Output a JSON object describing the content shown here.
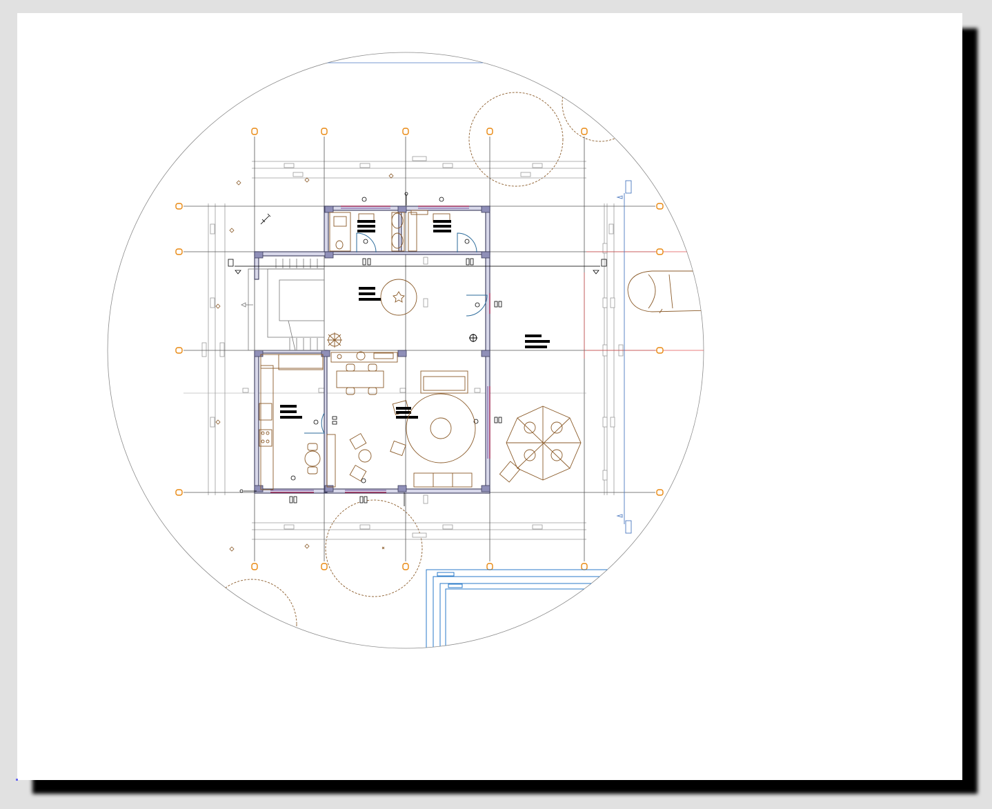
{
  "colors": {
    "workspace_bg": "#e1e1e1",
    "sheet_bg": "#ffffff",
    "shadow": "#000000",
    "grid_line": "#555555",
    "grid_bubble": "#e8870f",
    "wall_outline": "#3a3a5a",
    "wall_fill": "#d8d8ea",
    "column_fill": "#8f8fb8",
    "furniture": "#8a5a28",
    "dimension": "#9a9a9a",
    "window_red": "#9a1040",
    "window_purple": "#5a2a8a",
    "door_blue": "#2a6a9a",
    "pool_blue": "#2a7ac8",
    "section_blue": "#4a78c0",
    "red_ref": "#e05050",
    "view_circle": "#8a8a8a",
    "tree_outline": "#8a5a28"
  },
  "drawing": {
    "type": "architectural floor plan",
    "rooms": [
      "bathroom",
      "bathroom",
      "laundry",
      "stair hall",
      "kitchen",
      "dining",
      "living",
      "terrace"
    ],
    "icons": [
      "grid-bubble-icon",
      "tree-icon",
      "car-icon",
      "stair-icon",
      "door-swing-icon",
      "table-icon",
      "chair-icon",
      "sofa-icon",
      "rug-icon",
      "plant-icon",
      "umbrella-table-icon",
      "section-marker-icon"
    ]
  }
}
